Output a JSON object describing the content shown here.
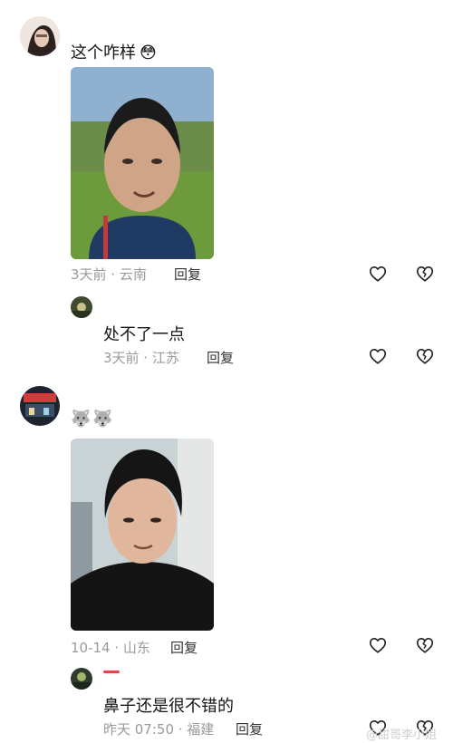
{
  "comments": [
    {
      "text": "这个咋样",
      "emoji": "😳",
      "meta": "3天前 · 云南",
      "reply_label": "回复",
      "reply": {
        "text": "处不了一点",
        "meta": "3天前 · 江苏",
        "reply_label": "回复"
      }
    },
    {
      "text": "",
      "emoji": "🐺🐺",
      "meta": "10-14 · 山东",
      "reply_label": "回复",
      "reply": {
        "text": "鼻子还是很不错的",
        "meta": "昨天 07:50 · 福建",
        "reply_label": "回复"
      }
    }
  ],
  "watermark": "@甜哥李小姐",
  "icons": {
    "like": "heart-outline-icon",
    "dislike": "broken-heart-icon"
  }
}
